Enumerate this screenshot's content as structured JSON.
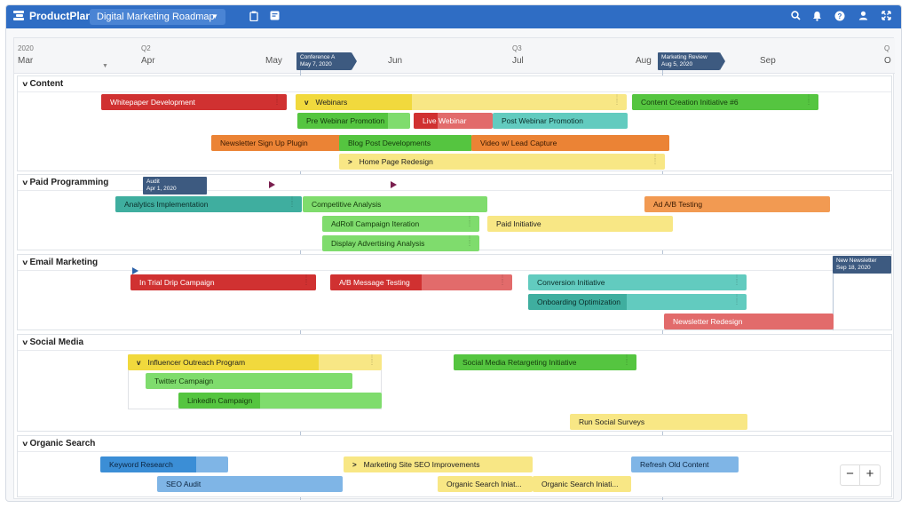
{
  "app": {
    "name": "ProductPlan",
    "roadmap": "Digital Marketing Roadmap"
  },
  "toolbar_icons": [
    "clipboard-icon",
    "notes-icon",
    "search-icon",
    "bell-icon",
    "help-icon",
    "user-icon",
    "expand-icon"
  ],
  "timeline": {
    "year": "2020",
    "quarters": [
      "Q2",
      "Q3",
      "Q"
    ],
    "months": [
      "Mar",
      "Apr",
      "May",
      "Jun",
      "Jul",
      "Aug",
      "Sep",
      "O"
    ]
  },
  "milestones": {
    "conference": {
      "title": "Conference A",
      "date": "May 7, 2020"
    },
    "review": {
      "title": "Marketing Review",
      "date": "Aug 5, 2020"
    },
    "audit": {
      "title": "Audit",
      "date": "Apr 1, 2020"
    },
    "newsletter": {
      "title": "New Newsletter",
      "date": "Sep 18, 2020"
    }
  },
  "sections": {
    "content": {
      "title": "Content",
      "bars": [
        "Whitepaper Development",
        "Webinars",
        "Content Creation Initiative #6",
        "Pre Webinar Promotion",
        "Live Webinar",
        "Post Webinar Promotion",
        "Newsletter Sign Up Plugin",
        "Blog Post Developments",
        "Video w/ Lead Capture",
        "Home Page Redesign"
      ]
    },
    "paid": {
      "title": "Paid Programming",
      "bars": [
        "Analytics Implementation",
        "Competitive Analysis",
        "Ad A/B Testing",
        "AdRoll Campaign Iteration",
        "Paid Initiative",
        "Display Advertising Analysis"
      ]
    },
    "email": {
      "title": "Email Marketing",
      "bars": [
        "In Trial Drip Campaign",
        "A/B Message Testing",
        "Conversion Initiative",
        "Onboarding Optimization",
        "Newsletter Redesign"
      ]
    },
    "social": {
      "title": "Social Media",
      "bars": [
        "Influencer Outreach Program",
        "Social Media Retargeting Initiative",
        "Twitter Campaign",
        "LinkedIn Campaign",
        "Run Social Surveys"
      ]
    },
    "organic": {
      "title": "Organic Search",
      "bars": [
        "Keyword Research",
        "Marketing Site SEO Improvements",
        "Refresh Old Content",
        "SEO Audit",
        "Organic Search Iniat...",
        "Organic Search Iniati..."
      ]
    }
  },
  "zoom": {
    "minus": "−",
    "plus": "+"
  },
  "colors": {
    "topbar": "#2f6dc4",
    "red": "#d03131",
    "yellow": "#f1d93d",
    "green": "#55c540",
    "teal": "#3fae9f",
    "orange": "#eb8335",
    "blue": "#3b8ed6"
  }
}
